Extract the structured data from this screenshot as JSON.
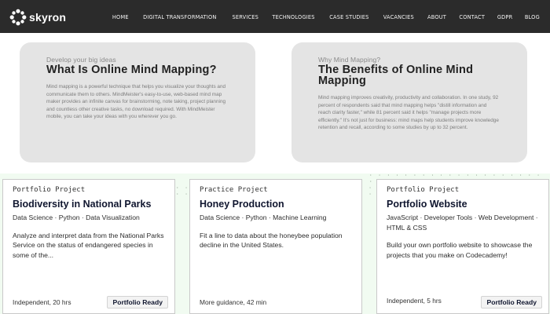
{
  "colors": {
    "nav_bg": "#2b2b2b",
    "article_card_bg": "#e4e4e4",
    "band_bg": "#f1fbf1",
    "title_dark": "#10162f"
  },
  "brand": {
    "name": "skyron",
    "icon": "skyron-logo-icon"
  },
  "nav": {
    "items": [
      "HOME",
      "DIGITAL TRANSFORMATION",
      "SERVICES",
      "TECHNOLOGIES",
      "CASE STUDIES",
      "VACANCIES",
      "ABOUT",
      "CONTACT",
      "GDPR",
      "BLOG"
    ]
  },
  "articles": [
    {
      "eyebrow": "Develop your big ideas",
      "title": "What Is Online Mind Mapping?",
      "body": "Mind mapping is a powerful technique that helps you visualize your thoughts and communicate them to others. MindMeister's easy-to-use, web-based mind map maker provides an infinite canvas for brainstorming, note taking, project planning and countless other creative tasks, no download required. With MindMeister mobile, you can take your ideas with you wherever you go."
    },
    {
      "eyebrow": "Why Mind Mapping?",
      "title": "The Benefits of Online Mind Mapping",
      "body": "Mind mapping improves creativity, productivity and collaboration. In one study, 92 percent of respondents said that mind mapping helps \"distill information and reach clarity faster,\" while 81 percent said it helps \"manage projects more efficiently.\" It's not just for business: mind maps help students improve knowledge retention and recall, according to some studies by up to 32 percent."
    }
  ],
  "projects": [
    {
      "type": "Portfolio Project",
      "title": "Biodiversity in National Parks",
      "tags": "Data Science · Python · Data Visualization",
      "description": "Analyze and interpret data from the National Parks Service on the status of endangered species in some of the...",
      "footer": "Independent, 20 hrs",
      "badge": "Portfolio Ready"
    },
    {
      "type": "Practice Project",
      "title": "Honey Production",
      "tags": "Data Science · Python · Machine Learning",
      "description": "Fit a line to data about the honeybee population decline in the United States.",
      "footer": "More guidance, 42 min",
      "badge": ""
    },
    {
      "type": "Portfolio Project",
      "title": "Portfolio Website",
      "tags": "JavaScript · Developer Tools · Web Development · HTML & CSS",
      "description": "Build your own portfolio website to showcase the projects that you make on Codecademy!",
      "footer": "Independent, 5 hrs",
      "badge": "Portfolio Ready"
    }
  ]
}
